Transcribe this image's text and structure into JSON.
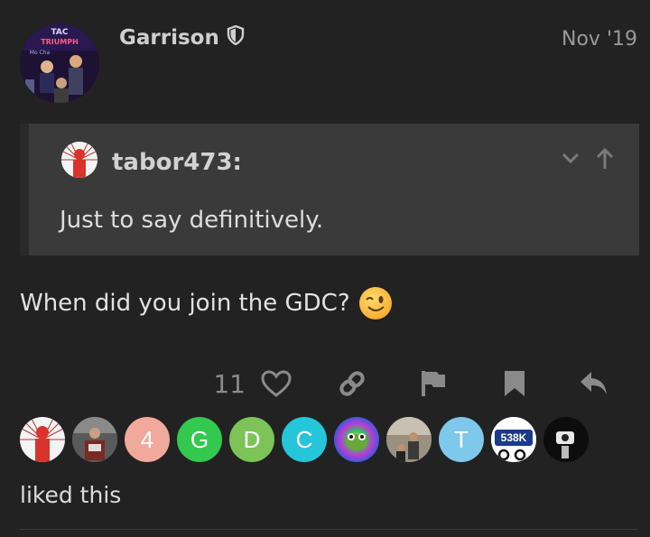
{
  "post": {
    "author": "Garrison",
    "date": "Nov '19",
    "avatar_text": [
      "TAC",
      "TRIUMPH",
      "Mo Cha"
    ],
    "body": "When did you join the GDC?",
    "emoji": "winking-face"
  },
  "quote": {
    "user": "tabor473:",
    "text": "Just to say definitively."
  },
  "actions": {
    "like_count": "11"
  },
  "likers": [
    {
      "letter": "",
      "color": "#f4f4f4"
    },
    {
      "letter": "",
      "color": "#6b6b6b"
    },
    {
      "letter": "4",
      "color": "#f0a99b"
    },
    {
      "letter": "G",
      "color": "#32c94e"
    },
    {
      "letter": "D",
      "color": "#7cc458"
    },
    {
      "letter": "C",
      "color": "#26c6da"
    },
    {
      "letter": "",
      "color": "#8a3cc8"
    },
    {
      "letter": "",
      "color": "#8a8172"
    },
    {
      "letter": "T",
      "color": "#7ec8ec"
    },
    {
      "letter": "538K",
      "color": "#ffffff"
    },
    {
      "letter": "",
      "color": "#0d0d0d"
    }
  ],
  "liked_label": "liked this",
  "colors": {
    "background": "#222222",
    "quote_bg": "#3a3a3a"
  }
}
